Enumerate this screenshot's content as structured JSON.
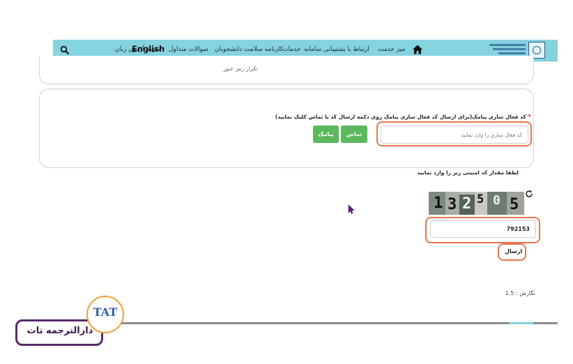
{
  "nav": {
    "items": [
      {
        "key": "service_desk",
        "label": "میز خدمت"
      },
      {
        "key": "support",
        "label": "ارتباط با پشتیبانی سامانه"
      },
      {
        "key": "services",
        "label": "خدمات"
      },
      {
        "key": "health",
        "label": "کارنامه سلامت دانشجویان"
      },
      {
        "key": "faq",
        "label": "سوالات متداول"
      },
      {
        "key": "calendar",
        "label": "تقویم آزمون زبان"
      }
    ],
    "english": "English"
  },
  "form": {
    "repeat_password_label": "تکرار رمز عبور",
    "sms_label": "کد فعال سازی پیامک(برای ارسال کد فعال سازی پیامک روی دکمه ارسال کد یا تماس کلیک نمایید)",
    "required_mark": "*",
    "code_placeholder": "کد فعال سازی را وارد نمایید",
    "call_button": "تماس",
    "sms_button": "پیامک",
    "captcha_instruction": "لطفا مقدار کد امنیتی زیر را وارد نمایید",
    "captcha_digits": [
      "1",
      "3",
      "2",
      "5",
      "0",
      "5"
    ],
    "captcha_value": "792153",
    "send_button": "ارسال",
    "version_label": "نگارش : 1.5"
  },
  "watermark": {
    "text": "دارالترجمه تات",
    "logo": "TAT"
  },
  "colors": {
    "navbar": "#86d3e0",
    "highlight": "#e8744d",
    "button_green": "#5cb85c",
    "watermark_border": "#5b2a6e"
  }
}
